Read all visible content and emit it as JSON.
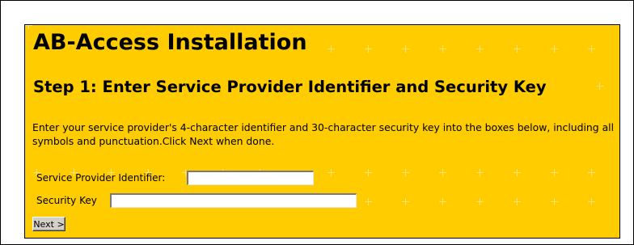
{
  "page": {
    "title": "AB-Access Installation"
  },
  "step": {
    "heading": "Step 1: Enter Service Provider Identifier and Security Key",
    "instructions": "Enter your service provider's 4-character identifier and 30-character security key into the boxes below, including all symbols and punctuation.Click Next when done."
  },
  "form": {
    "provider_id_label": "Service Provider Identifier:",
    "provider_id_value": "",
    "security_key_label": "Security Key",
    "security_key_value": "",
    "next_label": "Next >"
  },
  "colors": {
    "panel_background": "#ffcc00",
    "pattern_cross": "#ffe27a",
    "button_face": "#d4d0c8"
  },
  "icons": {
    "background_pattern": "plus-pattern-icon"
  }
}
